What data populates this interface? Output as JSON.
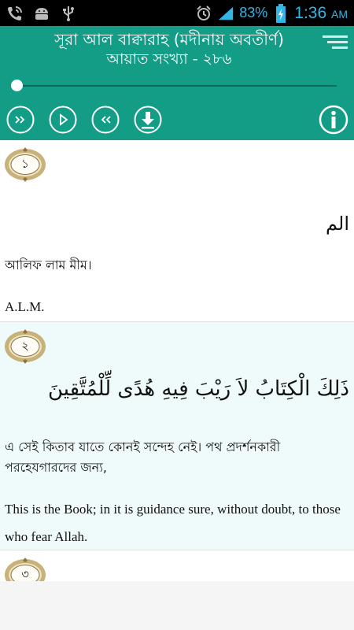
{
  "status_bar": {
    "battery": "83%",
    "time": "1:36",
    "ampm": "AM",
    "icons": [
      "phone-wifi-icon",
      "android-icon",
      "usb-icon",
      "alarm-icon",
      "signal-icon",
      "battery-icon"
    ]
  },
  "header": {
    "title": "সূরা আল বাক্বারাহ (মদীনায় অবতীর্ণ)",
    "subtitle": "আয়াত সংখ্যা - ২৮৬",
    "progress": 0,
    "controls": [
      "fast-forward-icon",
      "play-icon",
      "rewind-icon",
      "download-icon",
      "info-icon"
    ]
  },
  "colors": {
    "header_bg": "#139c86",
    "tint_row": "#effafa",
    "badge_gold": "#c8b27a"
  },
  "verses": [
    {
      "number": "১",
      "arabic": "الم",
      "bengali": "আলিফ লাম মীম।",
      "english": "A.L.M."
    },
    {
      "number": "২",
      "arabic": "ذَلِكَ الْكِتَابُ لاَ رَيْبَ فِيهِ هُدًى لِّلْمُتَّقِينَ",
      "bengali": "এ সেই কিতাব যাতে কোনই সন্দেহ নেই। পথ প্রদর্শনকারী পরহেযগারদের জন্য,",
      "english": "This is the Book; in it is guidance sure, without doubt, to those who fear Allah."
    },
    {
      "number": "৩"
    }
  ]
}
